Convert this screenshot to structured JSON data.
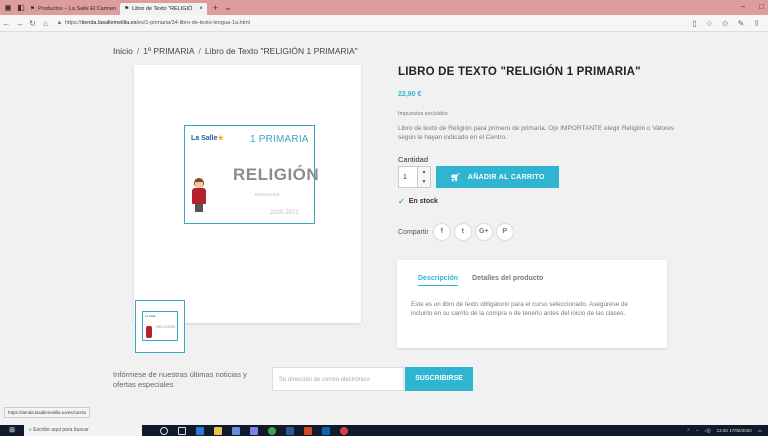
{
  "browser": {
    "tabs": [
      {
        "label": "Productos – La Salle El Carmen",
        "active": false
      },
      {
        "label": "Libro de Texto \"RELIGIÓ",
        "active": true
      }
    ],
    "url_prefix": "https://",
    "url_host": "tienda.lasallemelilla.es",
    "url_path": "/es/1-primaria/34-libro-de-texto-lengua-1a.html",
    "window_controls": [
      "–",
      "□"
    ]
  },
  "breadcrumb": {
    "home": "Inicio",
    "category": "1º PRIMARIA",
    "current": "Libro de Texto \"RELIGIÓN 1 PRIMARIA\""
  },
  "cover": {
    "logo": "La Salle",
    "grade": "1 PRIMARIA",
    "title": "RELIGIÓN",
    "publisher": "EDELVIVES",
    "years": "2020-2021"
  },
  "product": {
    "title": "LIBRO DE TEXTO \"RELIGIÓN 1 PRIMARIA\"",
    "price": "22,90 €",
    "tax_note": "Impuestos excluidos",
    "description": "Libro de texto de Religión para primero de primaria. Ojo IMPORTANTE elegir Religión o Valores según le hayan indicado en el Centro.",
    "quantity_label": "Cantidad",
    "quantity_value": "1",
    "add_to_cart": "AÑADIR AL CARRITO",
    "stock": "En stock",
    "share_label": "Compartir",
    "social": [
      "f",
      "t",
      "G+",
      "P"
    ]
  },
  "tabs": {
    "items": [
      "Descripción",
      "Detalles del producto"
    ],
    "active_text": "Este es un libro de texto obligatorio para el curso seleccionado. Asegúrese de incluirlo en su carrito de la compra o de tenerlo antes del inicio de las clases."
  },
  "newsletter": {
    "text": "Infórmese de nuestras últimas noticias y ofertas especiales",
    "placeholder": "Su dirección de correo electrónico",
    "button": "SUSCRIBIRSE"
  },
  "status_bar_url": "https://tienda.lasallemelilla.es/es/carrito",
  "taskbar": {
    "search_placeholder": "Escribe aquí para buscar",
    "time": "13:40",
    "date": "17/06/2020"
  },
  "colors": {
    "accent": "#2fb5d2",
    "tab_bar": "#dd9d9d",
    "in_stock": "#4cbb6c"
  }
}
